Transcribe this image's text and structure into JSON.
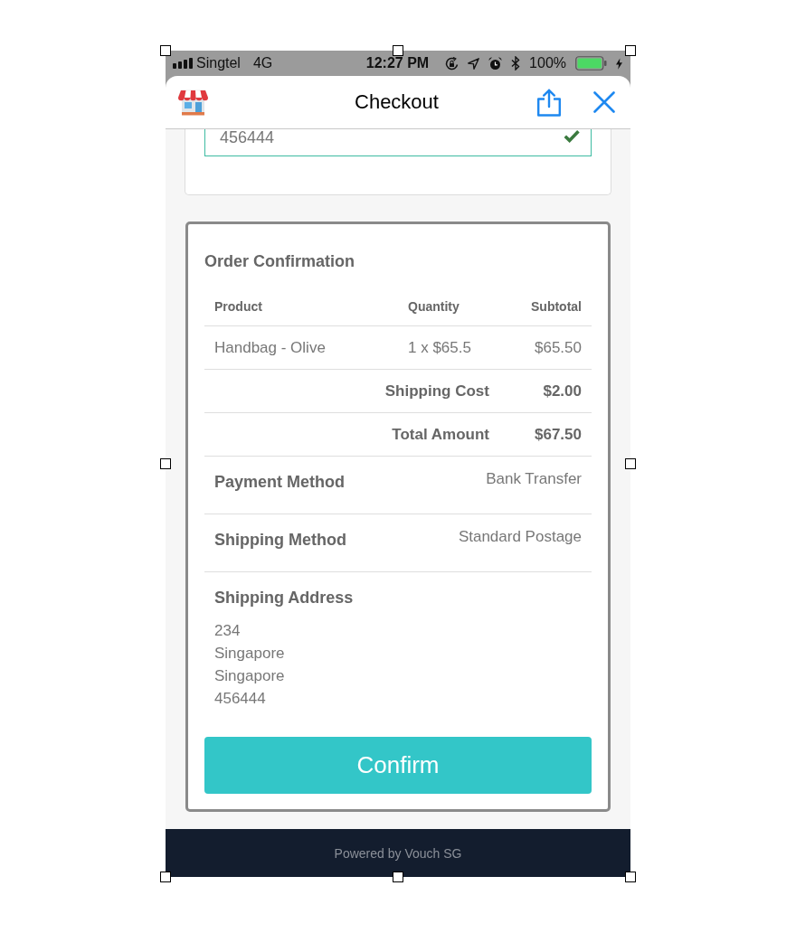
{
  "status_bar": {
    "carrier": "Singtel",
    "network": "4G",
    "time": "12:27 PM",
    "battery": "100%"
  },
  "header": {
    "title": "Checkout"
  },
  "upper_card": {
    "field": {
      "value": "456444",
      "valid": true
    }
  },
  "order_confirmation": {
    "title": "Order Confirmation",
    "columns": [
      "Product",
      "Quantity",
      "Subtotal"
    ],
    "items": [
      {
        "product": "Handbag - Olive",
        "quantity": "1 x $65.5",
        "subtotal": "$65.50"
      }
    ],
    "summary": [
      {
        "label": "Shipping Cost",
        "value": "$2.00"
      },
      {
        "label": "Total Amount",
        "value": "$67.50"
      }
    ],
    "details": [
      {
        "label": "Payment Method",
        "value": "Bank Transfer"
      },
      {
        "label": "Shipping Method",
        "value": "Standard Postage"
      }
    ],
    "shipping_address": {
      "label": "Shipping Address",
      "lines": [
        "234",
        "Singapore",
        "Singapore",
        "456444"
      ]
    },
    "confirm_button": {
      "label": "Confirm"
    }
  },
  "footer": {
    "text": "Powered by Vouch SG"
  }
}
